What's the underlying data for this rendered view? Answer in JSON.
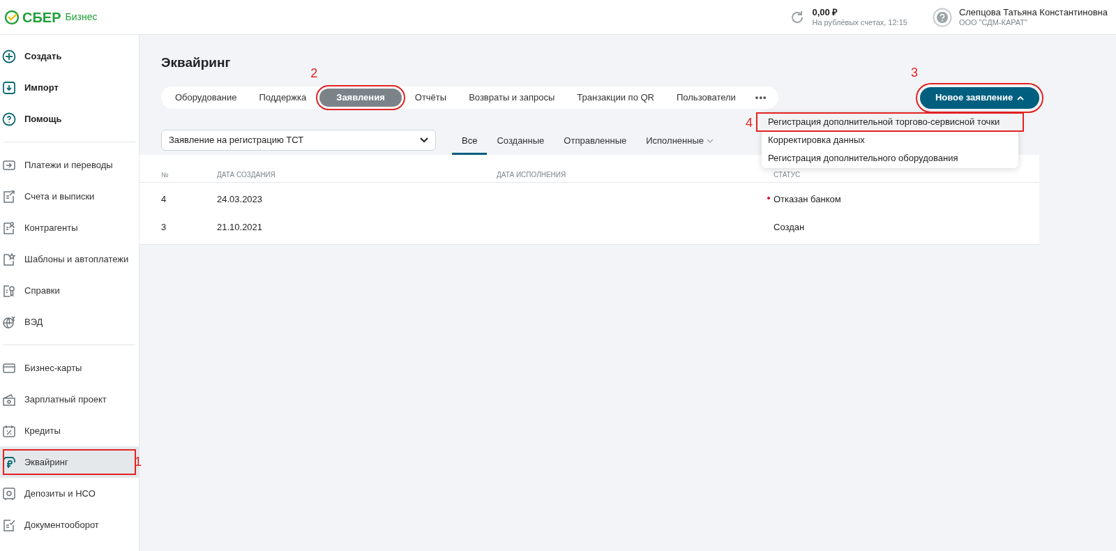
{
  "header": {
    "logo": "СБЕР",
    "logo_sub": "Бизнес",
    "balance": "0,00 ₽",
    "balance_note": "На рублёвых счетах, 12:15",
    "user_name": "Слепцова Татьяна Константиновна",
    "company": "ООО \"СДМ-КАРАТ\""
  },
  "sidebar": {
    "groups": [
      [
        {
          "label": "Создать",
          "kind": "action",
          "selected": false
        },
        {
          "label": "Импорт",
          "kind": "action",
          "selected": false
        },
        {
          "label": "Помощь",
          "kind": "action",
          "selected": false
        }
      ],
      [
        {
          "label": "Платежи и переводы",
          "kind": "nav",
          "selected": false
        },
        {
          "label": "Счета и выписки",
          "kind": "nav",
          "selected": false
        },
        {
          "label": "Контрагенты",
          "kind": "nav",
          "selected": false
        },
        {
          "label": "Шаблоны и автоплатежи",
          "kind": "nav",
          "selected": false
        },
        {
          "label": "Справки",
          "kind": "nav",
          "selected": false
        },
        {
          "label": "ВЭД",
          "kind": "nav",
          "selected": false
        }
      ],
      [
        {
          "label": "Бизнес-карты",
          "kind": "nav",
          "selected": false
        },
        {
          "label": "Зарплатный проект",
          "kind": "nav",
          "selected": false
        },
        {
          "label": "Кредиты",
          "kind": "nav",
          "selected": false
        },
        {
          "label": "Эквайринг",
          "kind": "nav",
          "selected": true,
          "annotation": "1"
        },
        {
          "label": "Депозиты и НСО",
          "kind": "nav",
          "selected": false
        },
        {
          "label": "Документооборот",
          "kind": "nav",
          "selected": false
        }
      ]
    ]
  },
  "page": {
    "title": "Эквайринг",
    "tabs": [
      {
        "label": "Оборудование",
        "selected": false
      },
      {
        "label": "Поддержка",
        "selected": false
      },
      {
        "label": "Заявления",
        "selected": true,
        "annotation": "2"
      },
      {
        "label": "Отчёты",
        "selected": false
      },
      {
        "label": "Возвраты и запросы",
        "selected": false
      },
      {
        "label": "Транзакции по QR",
        "selected": false
      },
      {
        "label": "Пользователи",
        "selected": false
      }
    ],
    "more": "•••",
    "new_button": {
      "label": "Новое заявление",
      "expanded": true,
      "annotation": "3"
    },
    "menu": [
      {
        "label": "Регистрация дополнительной торгово-сервисной точки",
        "selected": true,
        "annotation": "4"
      },
      {
        "label": "Корректировка данных",
        "selected": false
      },
      {
        "label": "Регистрация дополнительного оборудования",
        "selected": false
      }
    ],
    "filter": {
      "value": "Заявление на регистрацию ТСТ"
    },
    "status_tabs": [
      {
        "label": "Все",
        "selected": true,
        "has_menu": false
      },
      {
        "label": "Созданные",
        "selected": false,
        "has_menu": false
      },
      {
        "label": "Отправленные",
        "selected": false,
        "has_menu": false
      },
      {
        "label": "Исполненные",
        "selected": false,
        "has_menu": true
      }
    ],
    "table": {
      "columns": [
        "№",
        "ДАТА СОЗДАНИЯ",
        "ДАТА ИСПОЛНЕНИЯ",
        "СТАТУС"
      ],
      "rows": [
        {
          "number": "4",
          "created": "24.03.2023",
          "status": "Отказан банком",
          "color": "#c8102e"
        },
        {
          "number": "3",
          "created": "21.10.2021",
          "status": "Создан"
        }
      ]
    }
  }
}
